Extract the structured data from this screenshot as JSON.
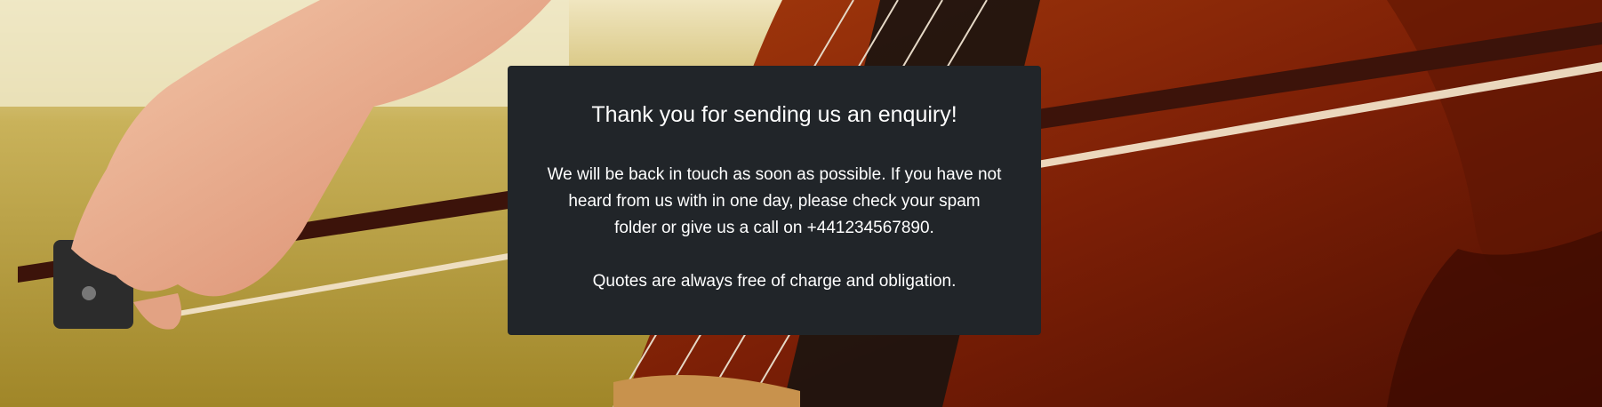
{
  "background": {
    "description_icon": "cello-bow-photo"
  },
  "confirmation": {
    "title": "Thank you for sending us an enquiry!",
    "message": "We will be back in touch as soon as possible. If you have not heard from us with in one day, please check your spam folder or give us a call on +441234567890.",
    "note": "Quotes are always free of charge and obligation."
  },
  "colors": {
    "card_background": "#212529",
    "text": "#ffffff"
  }
}
